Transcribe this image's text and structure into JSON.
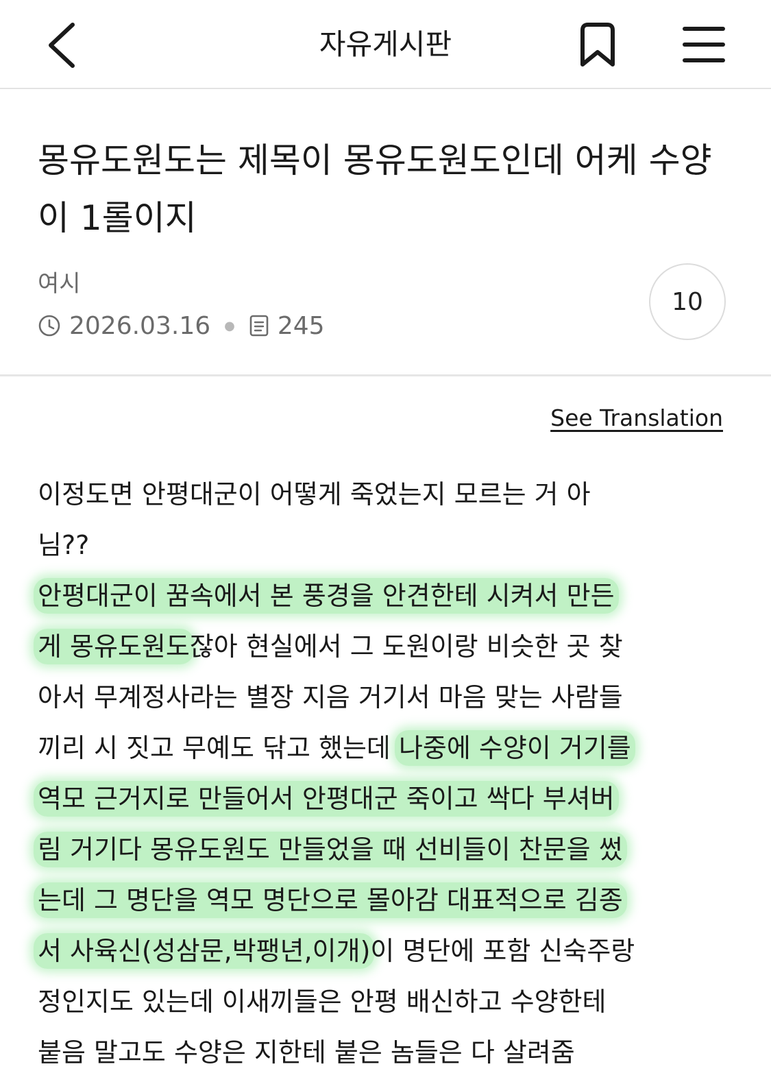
{
  "header": {
    "title": "자유게시판",
    "back_icon": "chevron-left-icon",
    "bookmark_icon": "bookmark-icon",
    "menu_icon": "hamburger-menu-icon"
  },
  "post": {
    "title": "몽유도원도는 제목이 몽유도원도인데 어케 수양이 1롤이지",
    "author": "여시",
    "date": "2026.03.16",
    "views": "245",
    "comment_count": "10",
    "translation_link": "See Translation"
  },
  "body": {
    "l1": "이정도면 안평대군이 어떻게 죽었는지 모르는 거 아",
    "l2": "님??",
    "l3_hl": "안평대군이 꿈속에서 본 풍경을 안견한테 시켜서 만든",
    "l4_hl": "게 몽유도원도",
    "l4_rest": "잖아 현실에서 그 도원이랑 비슷한 곳 찾",
    "l5": "아서 무계정사라는 별장 지음 거기서 마음 맞는 사람들",
    "l6_pre": "끼리 시 짓고 무예도 닦고 했는데 ",
    "l6_hl": "나중에 수양이 거기를",
    "l7_hl": "역모 근거지로 만들어서 안평대군 죽이고 싹다 부셔버",
    "l8_hl": "림 거기다 몽유도원도 만들었을 때 선비들이 찬문을 썼",
    "l9_hl": "는데 그 명단을 역모 명단으로 몰아감 대표적으로 김종",
    "l10_hl": "서 사육신(성삼문,박팽년,이개)",
    "l10_rest": "이 명단에 포함 신숙주랑",
    "l11": "정인지도 있는데 이새끼들은 안평 배신하고 수양한테",
    "l12": "붙음 말고도 수양은 지한테 붙은 놈들은 다 살려줌"
  },
  "colors": {
    "highlight": "#8ce696",
    "text": "#1a1a1a",
    "muted": "#6b6b6b",
    "divider": "#e6e6e6"
  }
}
